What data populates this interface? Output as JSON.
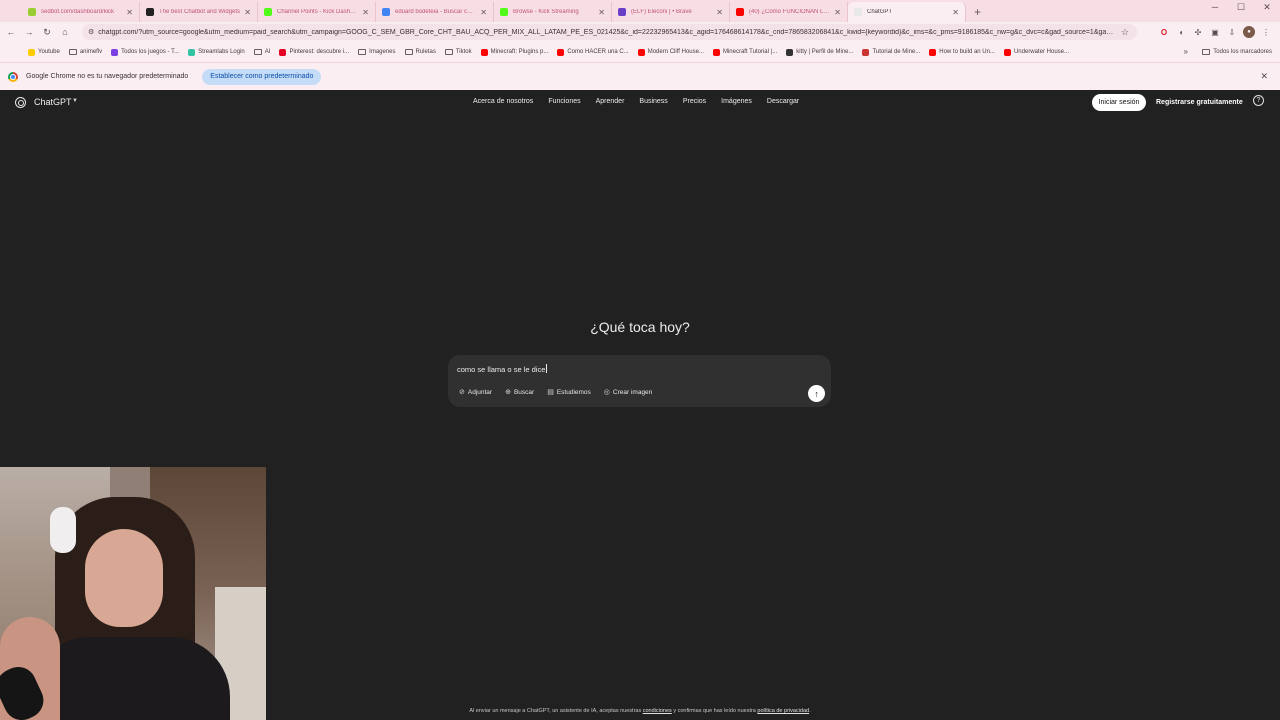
{
  "browser": {
    "tabs": [
      {
        "label": "sedbot.com/dashboard/kick",
        "color": "#9acd32",
        "active": false
      },
      {
        "label": "The best Chatbot and Widgets",
        "color": "#222222",
        "active": false
      },
      {
        "label": "Channel Points - Kick Dashboard",
        "color": "#53fc18",
        "active": false
      },
      {
        "label": "eduard bodeteia - Buscar con Google",
        "color": "#4285f4",
        "active": false
      },
      {
        "label": "Browse - Kick Streaming",
        "color": "#53fc18",
        "active": false
      },
      {
        "label": "(ELF) Eleconi | • Brave",
        "color": "#6a3fc8",
        "active": false
      },
      {
        "label": "(40) ¿Cómo FUNCIONAN LOS...",
        "color": "#ff0000",
        "active": false
      },
      {
        "label": "ChatGPT",
        "color": "#e8e8e8",
        "active": true
      }
    ],
    "new_tab": "+",
    "url": "chatgpt.com/?utm_source=google&utm_medium=paid_search&utm_campaign=GOOG_C_SEM_GBR_Core_CHT_BAU_ACQ_PER_MIX_ALL_LATAM_PE_ES_021425&c_id=22232965413&c_agid=176468614178&c_crid=786583206841&c_kwid={keywordid}&c_ims=&c_pms=9186185&c_nw=g&c_dvc=c&gad_source=1&gad_campaign...",
    "bookmarks": [
      {
        "label": "Youtube",
        "type": "icon",
        "color": "#ffcc00"
      },
      {
        "label": "animeflv",
        "type": "folder"
      },
      {
        "label": "Todos los juegos - T...",
        "type": "icon",
        "color": "#7b3fe4"
      },
      {
        "label": "Streamlabs Login",
        "type": "icon",
        "color": "#31c3a2"
      },
      {
        "label": "AI",
        "type": "folder"
      },
      {
        "label": "Pinterest: descubre i...",
        "type": "icon",
        "color": "#e60023"
      },
      {
        "label": "Imagenes",
        "type": "folder"
      },
      {
        "label": "Ruletas",
        "type": "folder"
      },
      {
        "label": "Tiktok",
        "type": "folder"
      },
      {
        "label": "Minecraft: Plugins p...",
        "type": "icon",
        "color": "#ff0000"
      },
      {
        "label": "Como HACER una C...",
        "type": "icon",
        "color": "#ff0000"
      },
      {
        "label": "Modern Cliff House...",
        "type": "icon",
        "color": "#ff0000"
      },
      {
        "label": "Minecraft Tutorial |...",
        "type": "icon",
        "color": "#ff0000"
      },
      {
        "label": "kitty | Perfil de Mine...",
        "type": "icon",
        "color": "#333333"
      },
      {
        "label": "Tutorial de Mine...",
        "type": "icon",
        "color": "#cc3333"
      },
      {
        "label": "How to build an Un...",
        "type": "icon",
        "color": "#ff0000"
      },
      {
        "label": "Underwater House...",
        "type": "icon",
        "color": "#ff0000"
      }
    ],
    "bookmarks_more": "»",
    "all_bookmarks": "Todos los marcadores",
    "infobar_text": "Google Chrome no es tu navegador predeterminado",
    "infobar_button": "Establecer como predeterminado"
  },
  "header": {
    "brand": "ChatGPT",
    "nav": [
      "Acerca de nosotros",
      "Funciones",
      "Aprender",
      "Business",
      "Precios",
      "Imágenes",
      "Descargar"
    ],
    "login": "Iniciar sesión",
    "register": "Registrarse gratuitamente"
  },
  "main": {
    "headline": "¿Qué toca hoy?",
    "input_value": "como se llama o se le dice",
    "tools": [
      {
        "label": "Adjuntar",
        "icon": "paperclip-icon"
      },
      {
        "label": "Buscar",
        "icon": "globe-icon"
      },
      {
        "label": "Estudiemos",
        "icon": "book-icon"
      },
      {
        "label": "Crear imagen",
        "icon": "image-icon"
      }
    ]
  },
  "footer": {
    "prefix": "Al enviar un mensaje a ChatGPT, un asistente de IA, aceptas nuestras ",
    "terms": "condiciones",
    "middle": " y confirmas que has leído nuestra ",
    "privacy": "política de privacidad",
    "suffix": "."
  }
}
